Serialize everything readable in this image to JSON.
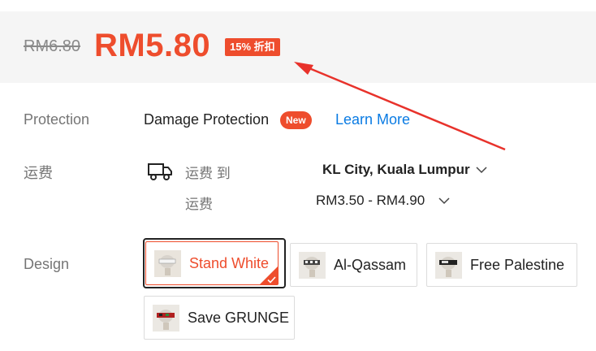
{
  "price": {
    "original": "RM6.80",
    "current": "RM5.80",
    "discount": "15% 折扣"
  },
  "protection": {
    "label": "Protection",
    "name": "Damage Protection",
    "badge": "New",
    "link": "Learn More"
  },
  "shipping": {
    "label": "运费",
    "to_label": "运费 到",
    "destination": "KL City, Kuala Lumpur",
    "fee_label": "运费",
    "fee_range": "RM3.50 - RM4.90"
  },
  "design": {
    "label": "Design",
    "options": [
      {
        "label": "Stand White",
        "selected": true
      },
      {
        "label": "Al-Qassam",
        "selected": false
      },
      {
        "label": "Free Palestine",
        "selected": false
      },
      {
        "label": "Save GRUNGE",
        "selected": false
      }
    ]
  },
  "colors": {
    "accent": "#ee4d2d",
    "link": "#0a7be3",
    "annotation_arrow": "#e8322b"
  },
  "icons": [
    "truck-icon",
    "chevron-down-icon",
    "checkmark-icon",
    "annotation-arrow"
  ]
}
